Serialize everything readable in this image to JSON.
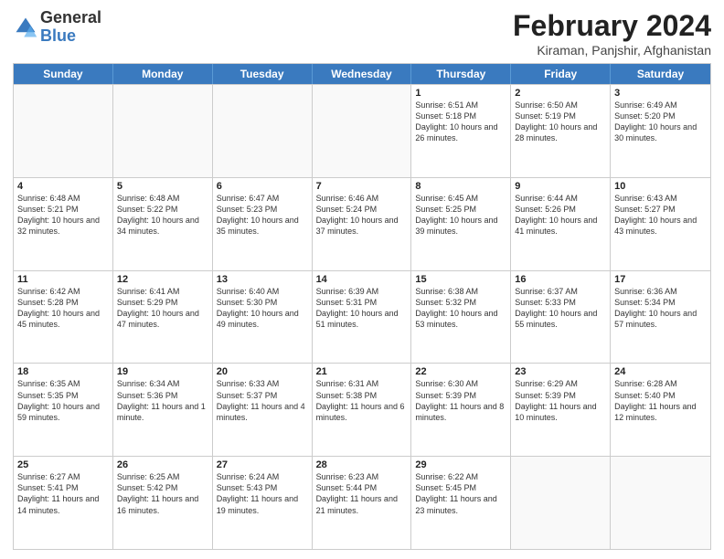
{
  "logo": {
    "general": "General",
    "blue": "Blue"
  },
  "title": {
    "month": "February 2024",
    "location": "Kiraman, Panjshir, Afghanistan"
  },
  "header_days": [
    "Sunday",
    "Monday",
    "Tuesday",
    "Wednesday",
    "Thursday",
    "Friday",
    "Saturday"
  ],
  "rows": [
    [
      {
        "day": "",
        "detail": "",
        "empty": true
      },
      {
        "day": "",
        "detail": "",
        "empty": true
      },
      {
        "day": "",
        "detail": "",
        "empty": true
      },
      {
        "day": "",
        "detail": "",
        "empty": true
      },
      {
        "day": "1",
        "detail": "Sunrise: 6:51 AM\nSunset: 5:18 PM\nDaylight: 10 hours and 26 minutes.",
        "empty": false
      },
      {
        "day": "2",
        "detail": "Sunrise: 6:50 AM\nSunset: 5:19 PM\nDaylight: 10 hours and 28 minutes.",
        "empty": false
      },
      {
        "day": "3",
        "detail": "Sunrise: 6:49 AM\nSunset: 5:20 PM\nDaylight: 10 hours and 30 minutes.",
        "empty": false
      }
    ],
    [
      {
        "day": "4",
        "detail": "Sunrise: 6:48 AM\nSunset: 5:21 PM\nDaylight: 10 hours and 32 minutes.",
        "empty": false
      },
      {
        "day": "5",
        "detail": "Sunrise: 6:48 AM\nSunset: 5:22 PM\nDaylight: 10 hours and 34 minutes.",
        "empty": false
      },
      {
        "day": "6",
        "detail": "Sunrise: 6:47 AM\nSunset: 5:23 PM\nDaylight: 10 hours and 35 minutes.",
        "empty": false
      },
      {
        "day": "7",
        "detail": "Sunrise: 6:46 AM\nSunset: 5:24 PM\nDaylight: 10 hours and 37 minutes.",
        "empty": false
      },
      {
        "day": "8",
        "detail": "Sunrise: 6:45 AM\nSunset: 5:25 PM\nDaylight: 10 hours and 39 minutes.",
        "empty": false
      },
      {
        "day": "9",
        "detail": "Sunrise: 6:44 AM\nSunset: 5:26 PM\nDaylight: 10 hours and 41 minutes.",
        "empty": false
      },
      {
        "day": "10",
        "detail": "Sunrise: 6:43 AM\nSunset: 5:27 PM\nDaylight: 10 hours and 43 minutes.",
        "empty": false
      }
    ],
    [
      {
        "day": "11",
        "detail": "Sunrise: 6:42 AM\nSunset: 5:28 PM\nDaylight: 10 hours and 45 minutes.",
        "empty": false
      },
      {
        "day": "12",
        "detail": "Sunrise: 6:41 AM\nSunset: 5:29 PM\nDaylight: 10 hours and 47 minutes.",
        "empty": false
      },
      {
        "day": "13",
        "detail": "Sunrise: 6:40 AM\nSunset: 5:30 PM\nDaylight: 10 hours and 49 minutes.",
        "empty": false
      },
      {
        "day": "14",
        "detail": "Sunrise: 6:39 AM\nSunset: 5:31 PM\nDaylight: 10 hours and 51 minutes.",
        "empty": false
      },
      {
        "day": "15",
        "detail": "Sunrise: 6:38 AM\nSunset: 5:32 PM\nDaylight: 10 hours and 53 minutes.",
        "empty": false
      },
      {
        "day": "16",
        "detail": "Sunrise: 6:37 AM\nSunset: 5:33 PM\nDaylight: 10 hours and 55 minutes.",
        "empty": false
      },
      {
        "day": "17",
        "detail": "Sunrise: 6:36 AM\nSunset: 5:34 PM\nDaylight: 10 hours and 57 minutes.",
        "empty": false
      }
    ],
    [
      {
        "day": "18",
        "detail": "Sunrise: 6:35 AM\nSunset: 5:35 PM\nDaylight: 10 hours and 59 minutes.",
        "empty": false
      },
      {
        "day": "19",
        "detail": "Sunrise: 6:34 AM\nSunset: 5:36 PM\nDaylight: 11 hours and 1 minute.",
        "empty": false
      },
      {
        "day": "20",
        "detail": "Sunrise: 6:33 AM\nSunset: 5:37 PM\nDaylight: 11 hours and 4 minutes.",
        "empty": false
      },
      {
        "day": "21",
        "detail": "Sunrise: 6:31 AM\nSunset: 5:38 PM\nDaylight: 11 hours and 6 minutes.",
        "empty": false
      },
      {
        "day": "22",
        "detail": "Sunrise: 6:30 AM\nSunset: 5:39 PM\nDaylight: 11 hours and 8 minutes.",
        "empty": false
      },
      {
        "day": "23",
        "detail": "Sunrise: 6:29 AM\nSunset: 5:39 PM\nDaylight: 11 hours and 10 minutes.",
        "empty": false
      },
      {
        "day": "24",
        "detail": "Sunrise: 6:28 AM\nSunset: 5:40 PM\nDaylight: 11 hours and 12 minutes.",
        "empty": false
      }
    ],
    [
      {
        "day": "25",
        "detail": "Sunrise: 6:27 AM\nSunset: 5:41 PM\nDaylight: 11 hours and 14 minutes.",
        "empty": false
      },
      {
        "day": "26",
        "detail": "Sunrise: 6:25 AM\nSunset: 5:42 PM\nDaylight: 11 hours and 16 minutes.",
        "empty": false
      },
      {
        "day": "27",
        "detail": "Sunrise: 6:24 AM\nSunset: 5:43 PM\nDaylight: 11 hours and 19 minutes.",
        "empty": false
      },
      {
        "day": "28",
        "detail": "Sunrise: 6:23 AM\nSunset: 5:44 PM\nDaylight: 11 hours and 21 minutes.",
        "empty": false
      },
      {
        "day": "29",
        "detail": "Sunrise: 6:22 AM\nSunset: 5:45 PM\nDaylight: 11 hours and 23 minutes.",
        "empty": false
      },
      {
        "day": "",
        "detail": "",
        "empty": true
      },
      {
        "day": "",
        "detail": "",
        "empty": true
      }
    ]
  ]
}
